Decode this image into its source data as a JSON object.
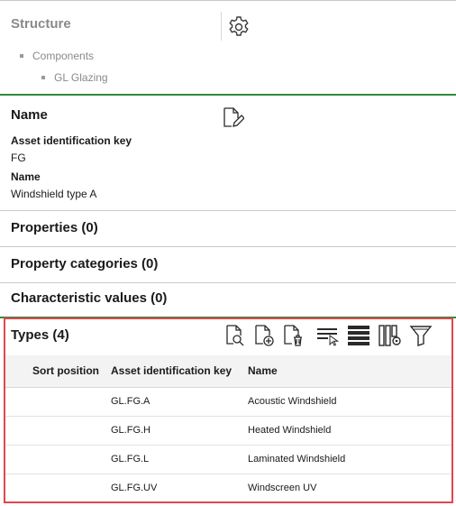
{
  "structure": {
    "title": "Structure",
    "tree": [
      "Components",
      "GL Glazing"
    ]
  },
  "name_section": {
    "title": "Name",
    "fields": [
      {
        "label": "Asset identification key",
        "value": "FG"
      },
      {
        "label": "Name",
        "value": "Windshield type A"
      }
    ]
  },
  "sections": {
    "properties": "Properties (0)",
    "property_categories": "Property categories (0)",
    "characteristic_values": "Characteristic values (0)"
  },
  "types": {
    "title": "Types (4)",
    "columns": [
      "Sort position",
      "Asset identification key",
      "Name"
    ],
    "rows": [
      {
        "sort": "",
        "key": "GL.FG.A",
        "name": "Acoustic Windshield"
      },
      {
        "sort": "",
        "key": "GL.FG.H",
        "name": "Heated Windshield"
      },
      {
        "sort": "",
        "key": "GL.FG.L",
        "name": "Laminated Windshield"
      },
      {
        "sort": "",
        "key": "GL.FG.UV",
        "name": "Windscreen UV"
      }
    ],
    "toolbar": [
      "view-details-icon",
      "add-document-icon",
      "delete-document-icon",
      "select-rows-icon",
      "show-all-rows-icon",
      "column-settings-icon",
      "filter-icon"
    ]
  },
  "colors": {
    "accent_green": "#2e8b3e",
    "highlight_red": "#e0474c"
  }
}
